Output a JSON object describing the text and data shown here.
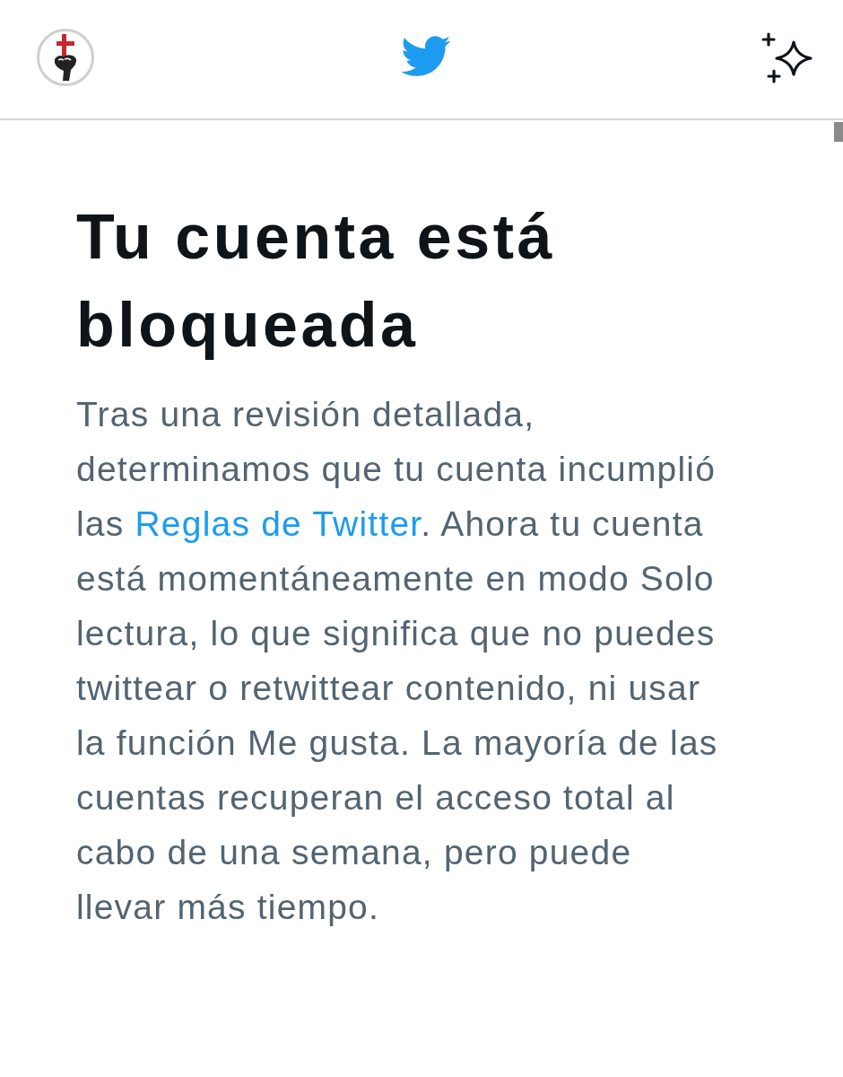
{
  "heading": "Tu cuenta está bloqueada",
  "body": {
    "before": "Tras una revisión detallada, determinamos que tu cuenta incumplió las ",
    "link": "Reglas de Twitter",
    "after": ". Ahora tu cuenta está momentáneamente en modo Solo lectura, lo que significa que no puedes twittear o retwittear contenido, ni usar la función Me gusta. La mayoría de las cuentas recuperan el acceso total al cabo de una semana, pero puede llevar más tiempo."
  }
}
